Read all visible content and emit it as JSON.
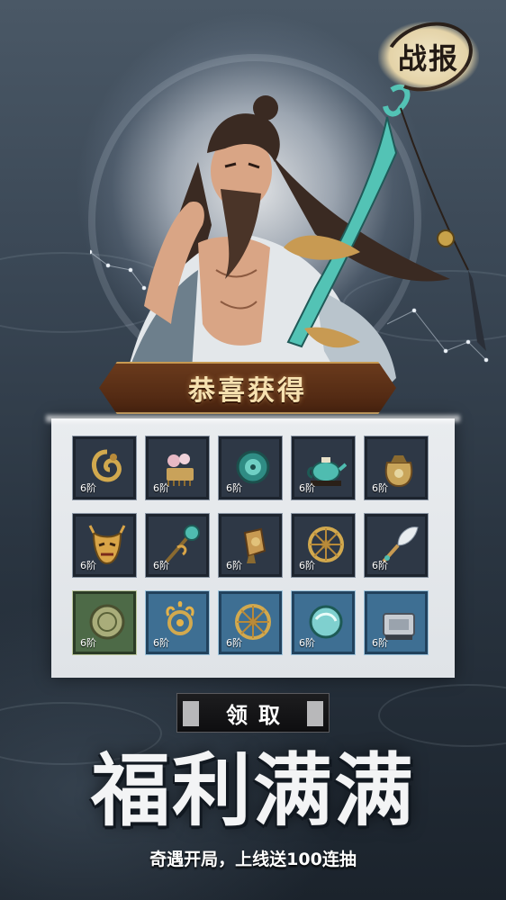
{
  "report_badge": {
    "label": "战报"
  },
  "banner": {
    "title": "恭喜获得"
  },
  "rewards": [
    {
      "tier": "6阶",
      "icon": "dragon-ring-icon",
      "frame": "dark"
    },
    {
      "tier": "6阶",
      "icon": "flower-comb-icon",
      "frame": "dark"
    },
    {
      "tier": "6阶",
      "icon": "jade-mirror-icon",
      "frame": "dark"
    },
    {
      "tier": "6阶",
      "icon": "teapot-icon",
      "frame": "dark"
    },
    {
      "tier": "6阶",
      "icon": "pouch-icon",
      "frame": "dark"
    },
    {
      "tier": "6阶",
      "icon": "demon-mask-icon",
      "frame": "dark"
    },
    {
      "tier": "6阶",
      "icon": "jade-staff-icon",
      "frame": "dark"
    },
    {
      "tier": "6阶",
      "icon": "lantern-icon",
      "frame": "dark"
    },
    {
      "tier": "6阶",
      "icon": "wheel-icon",
      "frame": "dark"
    },
    {
      "tier": "6阶",
      "icon": "feather-fan-icon",
      "frame": "dark"
    },
    {
      "tier": "6阶",
      "icon": "round-talisman-icon",
      "frame": "green"
    },
    {
      "tier": "6阶",
      "icon": "flame-ring-icon",
      "frame": "blue"
    },
    {
      "tier": "6阶",
      "icon": "wheel-icon",
      "frame": "blue"
    },
    {
      "tier": "6阶",
      "icon": "jade-orb-icon",
      "frame": "blue"
    },
    {
      "tier": "6阶",
      "icon": "silver-box-icon",
      "frame": "blue"
    }
  ],
  "claim_button": {
    "label": "领取"
  },
  "slogan": {
    "title": "福利满满",
    "subtitle": "奇遇开局，上线送100连抽"
  },
  "colors": {
    "banner": "#5a2e14",
    "banner_text": "#f6e1b0",
    "panel": "#e6e9ec",
    "slot_dark": "#2e3846",
    "slot_green": "#4d6a47",
    "slot_blue": "#3e6f93"
  }
}
